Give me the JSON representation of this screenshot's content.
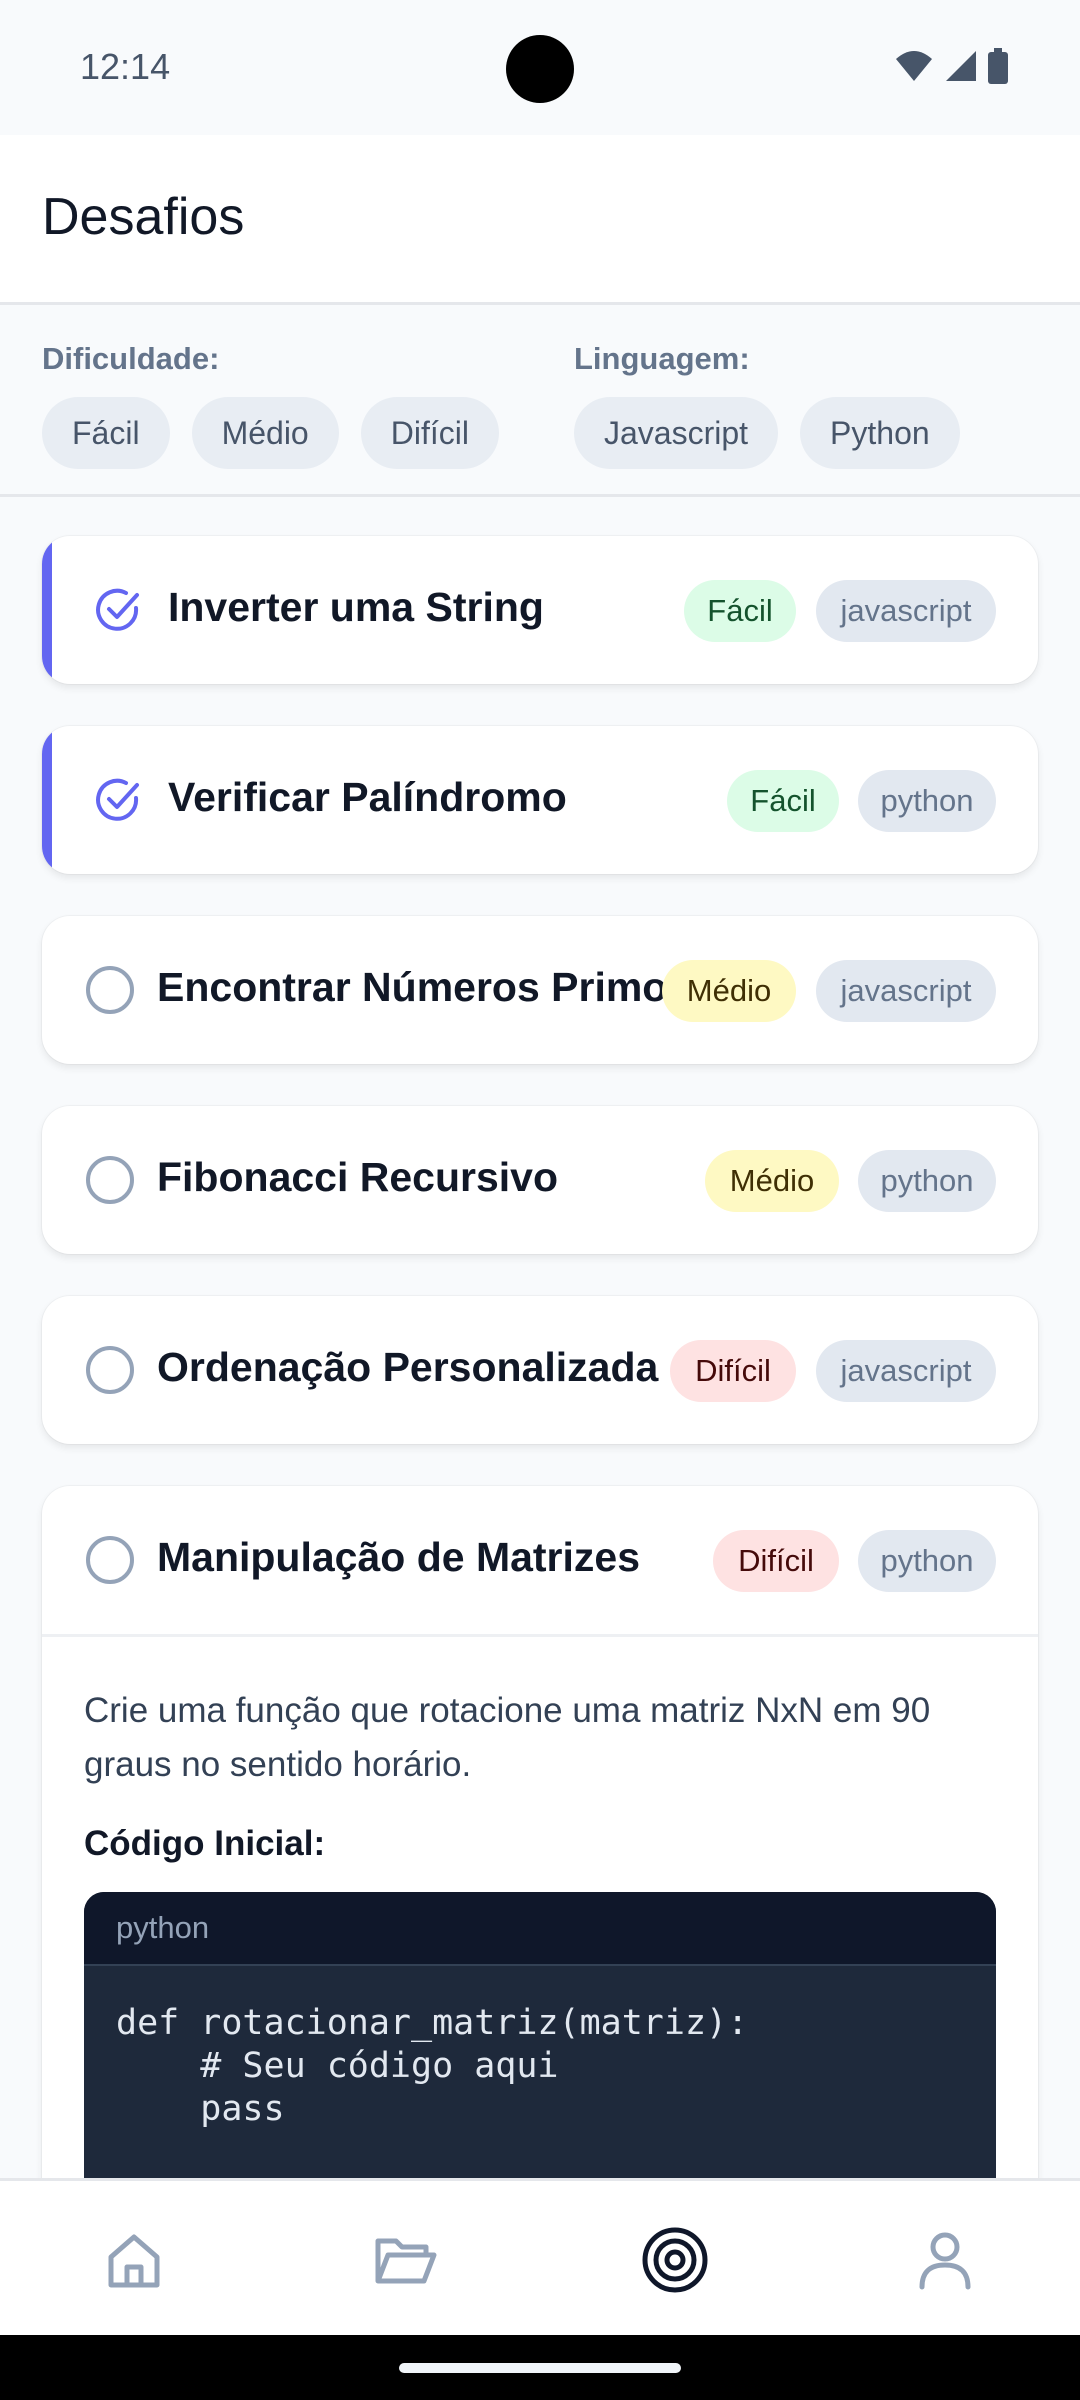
{
  "status_bar": {
    "time": "12:14"
  },
  "header": {
    "title": "Desafios"
  },
  "filters": {
    "difficulty_label": "Dificuldade:",
    "difficulty_options": [
      "Fácil",
      "Médio",
      "Difícil"
    ],
    "language_label": "Linguagem:",
    "language_options": [
      "Javascript",
      "Python"
    ]
  },
  "challenges": [
    {
      "title": "Inverter uma String",
      "difficulty": "Fácil",
      "language": "javascript",
      "completed": true
    },
    {
      "title": "Verificar Palíndromo",
      "difficulty": "Fácil",
      "language": "python",
      "completed": true
    },
    {
      "title": "Encontrar Números Primos",
      "difficulty": "Médio",
      "language": "javascript",
      "completed": false
    },
    {
      "title": "Fibonacci Recursivo",
      "difficulty": "Médio",
      "language": "python",
      "completed": false
    },
    {
      "title": "Ordenação Personalizada",
      "difficulty": "Difícil",
      "language": "javascript",
      "completed": false
    },
    {
      "title": "Manipulação de Matrizes",
      "difficulty": "Difícil",
      "language": "python",
      "completed": false,
      "description": "Crie uma função que rotacione uma matriz NxN em 90 graus no sentido horário.",
      "code_label": "Código Inicial:",
      "code_language": "python",
      "code": "def rotacionar_matriz(matriz):\n    # Seu código aqui\n    pass"
    }
  ],
  "colors": {
    "accent": "#6366f1",
    "easy_bg": "#dcfce7",
    "medium_bg": "#fef9c3",
    "hard_bg": "#fee2e2"
  },
  "bottom_nav": {
    "items": [
      "home-icon",
      "folder-icon",
      "target-icon",
      "profile-icon"
    ],
    "active": "target-icon"
  }
}
